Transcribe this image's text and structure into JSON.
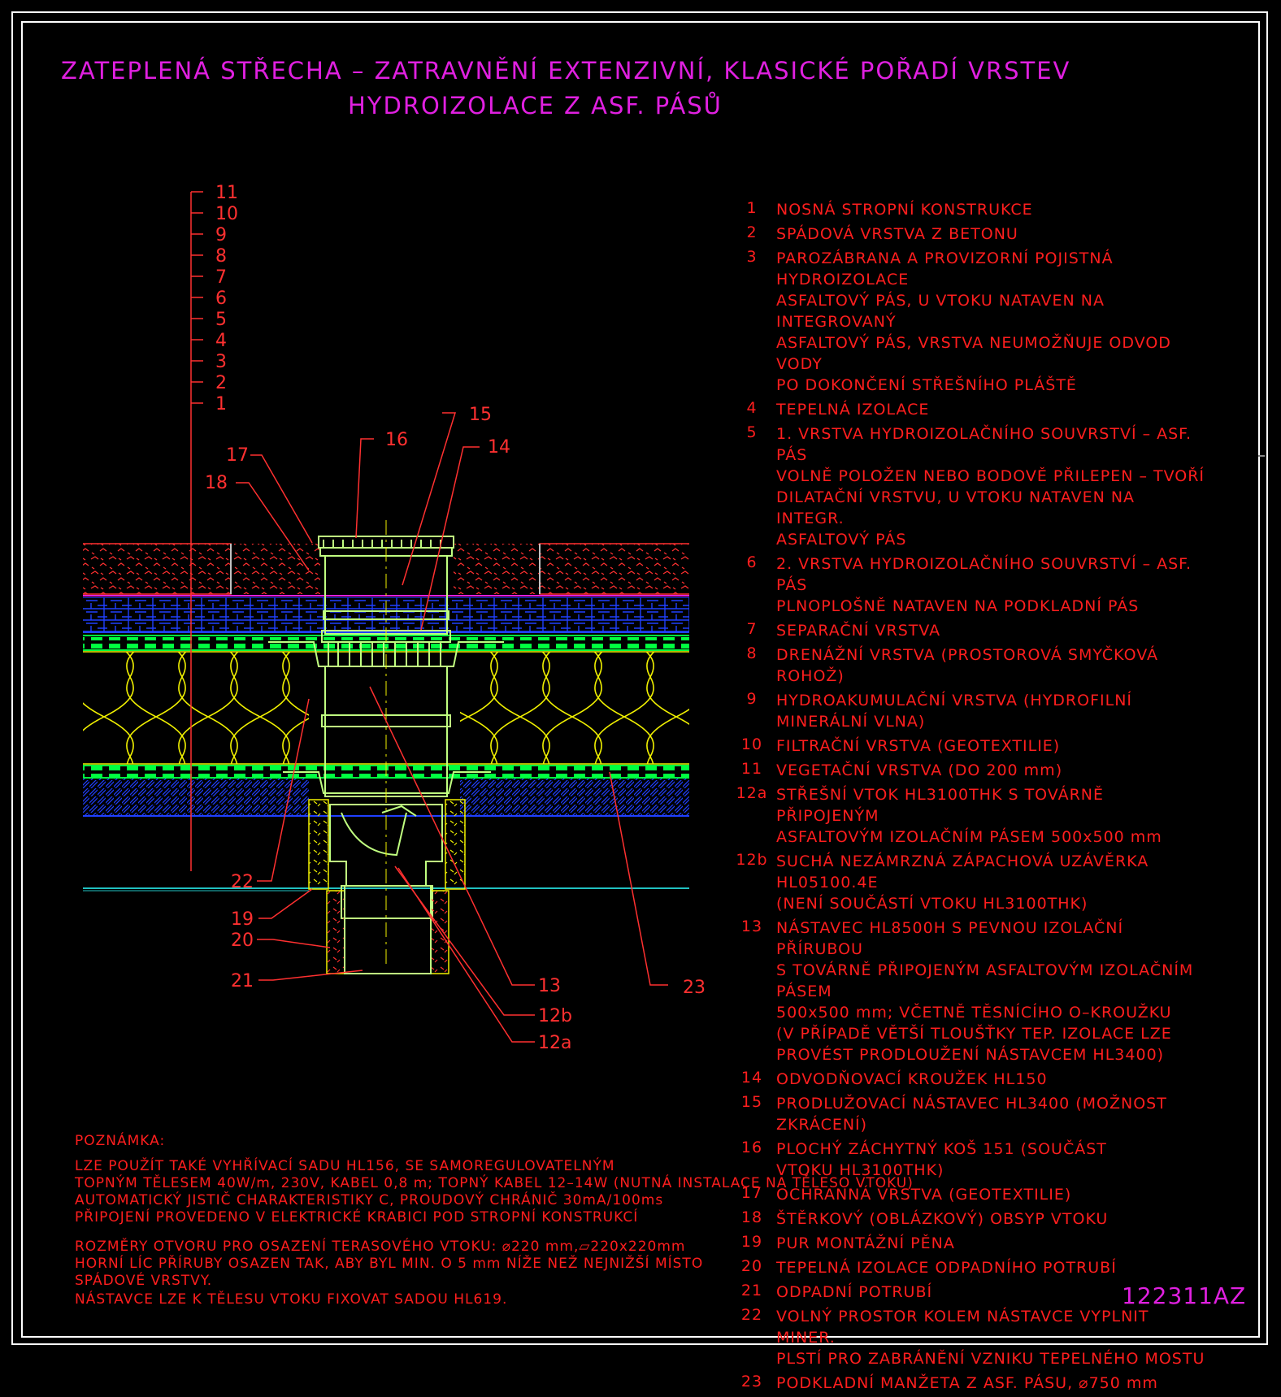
{
  "title": {
    "line1": "ZATEPLENÁ STŘECHA – ZATRAVNĚNÍ EXTENZIVNÍ, KLASICKÉ POŘADÍ VRSTEV",
    "line2": "HYDROIZOLACE Z ASF. PÁSŮ"
  },
  "layer_scale": [
    "11",
    "10",
    "9",
    "8",
    "7",
    "6",
    "5",
    "4",
    "3",
    "2",
    "1"
  ],
  "callouts": [
    "15",
    "16",
    "14",
    "17",
    "18",
    "22",
    "19",
    "20",
    "21",
    "13",
    "12b",
    "12a",
    "23"
  ],
  "legend": [
    {
      "num": "1",
      "text": "NOSNÁ STROPNÍ KONSTRUKCE"
    },
    {
      "num": "2",
      "text": "SPÁDOVÁ VRSTVA Z BETONU"
    },
    {
      "num": "3",
      "text": "PAROZÁBRANA A PROVIZORNÍ POJISTNÁ HYDROIZOLACE\nASFALTOVÝ PÁS, U VTOKU NATAVEN NA INTEGROVANÝ\nASFALTOVÝ PÁS, VRSTVA NEUMOŽŇUJE ODVOD VODY\nPO DOKONČENÍ STŘEŠNÍHO PLÁŠTĚ"
    },
    {
      "num": "4",
      "text": "TEPELNÁ IZOLACE"
    },
    {
      "num": "5",
      "text": "1. VRSTVA HYDROIZOLAČNÍHO SOUVRSTVÍ – ASF. PÁS\nVOLNĚ POLOŽEN NEBO BODOVĚ PŘILEPEN – TVOŘÍ\nDILATAČNÍ VRSTVU, U VTOKU NATAVEN NA INTEGR.\nASFALTOVÝ PÁS"
    },
    {
      "num": "6",
      "text": "2. VRSTVA HYDROIZOLAČNÍHO SOUVRSTVÍ – ASF. PÁS\nPLNOPLOŠNĚ NATAVEN NA PODKLADNÍ PÁS"
    },
    {
      "num": "7",
      "text": "SEPARAČNÍ VRSTVA"
    },
    {
      "num": "8",
      "text": "DRENÁŽNÍ VRSTVA (PROSTOROVÁ SMYČKOVÁ ROHOŽ)"
    },
    {
      "num": "9",
      "text": "HYDROAKUMULAČNÍ VRSTVA (HYDROFILNÍ MINERÁLNÍ VLNA)"
    },
    {
      "num": "10",
      "text": "FILTRAČNÍ VRSTVA (GEOTEXTILIE)"
    },
    {
      "num": "11",
      "text": "VEGETAČNÍ VRSTVA (DO 200 mm)"
    },
    {
      "num": "12a",
      "text": "STŘEŠNÍ VTOK HL3100THK S TOVÁRNĚ PŘIPOJENÝM\nASFALTOVÝM IZOLAČNÍM PÁSEM 500x500 mm"
    },
    {
      "num": "12b",
      "text": "SUCHÁ NEZÁMRZNÁ ZÁPACHOVÁ UZÁVĚRKA HL05100.4E\n(NENÍ SOUČÁSTÍ VTOKU HL3100THK)"
    },
    {
      "num": "13",
      "text": "NÁSTAVEC HL8500H S PEVNOU IZOLAČNÍ PŘÍRUBOU\nS TOVÁRNĚ PŘIPOJENÝM ASFALTOVÝM IZOLAČNÍM PÁSEM\n500x500 mm; VČETNĚ TĚSNÍCÍHO O–KROUŽKU\n(V PŘÍPADĚ VĚTŠÍ TLOUŠŤKY TEP. IZOLACE LZE\nPROVÉST PRODLOUŽENÍ NÁSTAVCEM HL3400)"
    },
    {
      "num": "14",
      "text": "ODVODŇOVACÍ KROUŽEK HL150"
    },
    {
      "num": "15",
      "text": "PRODLUŽOVACÍ NÁSTAVEC HL3400 (MOŽNOST ZKRÁCENÍ)"
    },
    {
      "num": "16",
      "text": "PLOCHÝ ZÁCHYTNÝ KOŠ 151 (SOUČÁST\nVTOKU HL3100THK)"
    },
    {
      "num": "17",
      "text": "OCHRANNÁ VRSTVA (GEOTEXTILIE)"
    },
    {
      "num": "18",
      "text": "ŠTĚRKOVÝ (OBLÁZKOVÝ) OBSYP VTOKU"
    },
    {
      "num": "19",
      "text": "PUR MONTÁŽNÍ PĚNA"
    },
    {
      "num": "20",
      "text": "TEPELNÁ IZOLACE ODPADNÍHO POTRUBÍ"
    },
    {
      "num": "21",
      "text": "ODPADNÍ POTRUBÍ"
    },
    {
      "num": "22",
      "text": "VOLNÝ PROSTOR KOLEM NÁSTAVCE VYPLNIT MINER.\nPLSTÍ PRO ZABRÁNĚNÍ VZNIKU TEPELNÉHO MOSTU"
    },
    {
      "num": "23",
      "text": "PODKLADNÍ MANŽETA Z ASF. PÁSU, ⌀750 mm"
    }
  ],
  "note": {
    "heading": "POZNÁMKA:",
    "paragraph1": "LZE POUŽÍT TAKÉ VYHŘÍVACÍ SADU HL156, SE SAMOREGULOVATELNÝM\nTOPNÝM TĚLESEM 40W/m, 230V, KABEL 0,8 m; TOPNÝ KABEL 12–14W (NUTNÁ INSTALACE NA TĚLESO VTOKU)\nAUTOMATICKÝ JISTIČ CHARAKTERISTIKY C, PROUDOVÝ CHRÁNIČ 30mA/100ms\nPŘIPOJENÍ PROVEDENO V ELEKTRICKÉ KRABICI POD STROPNÍ KONSTRUKCÍ",
    "paragraph2": "ROZMĚRY OTVORU PRO OSAZENÍ TERASOVÉHO VTOKU: ⌀220 mm,▱220x220mm\nHORNÍ LÍC PŘÍRUBY OSAZEN TAK, ABY BYL MIN. O 5 mm NÍŽE NEŽ NEJNIŽŠÍ MÍSTO\nSPÁDOVÉ VRSTVY.",
    "paragraph3": "NÁSTAVCE LZE K TĚLESU VTOKU FIXOVAT SADOU HL619."
  },
  "drawing_code": "122311AZ",
  "colors": {
    "frame": "#ffffff",
    "title": "#e020e0",
    "text": "#ff1e1e",
    "gravel": "#ff3030",
    "membrane": "#00ff40",
    "insulation": "#f0f000",
    "blue": "#2040ff",
    "cyan": "#20c0c0",
    "drain": "#c0ff80"
  }
}
